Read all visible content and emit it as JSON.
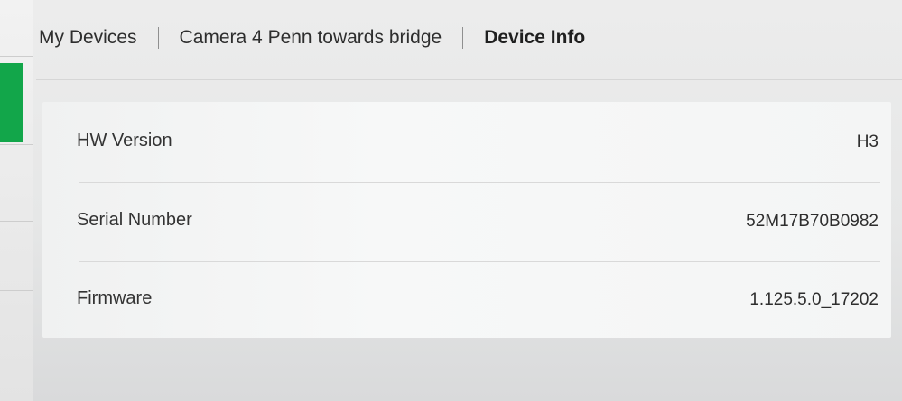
{
  "breadcrumb": {
    "items": [
      {
        "label": "My Devices"
      },
      {
        "label": "Camera 4 Penn towards bridge"
      },
      {
        "label": "Device Info"
      }
    ]
  },
  "device_info": {
    "rows": [
      {
        "label": "HW Version",
        "value": "H3"
      },
      {
        "label": "Serial Number",
        "value": "52M17B70B0982"
      },
      {
        "label": "Firmware",
        "value": "1.125.5.0_17202"
      }
    ]
  },
  "colors": {
    "accent": "#12a64a",
    "card_background": "#f4f5f5",
    "page_background": "#e6e7e7"
  }
}
